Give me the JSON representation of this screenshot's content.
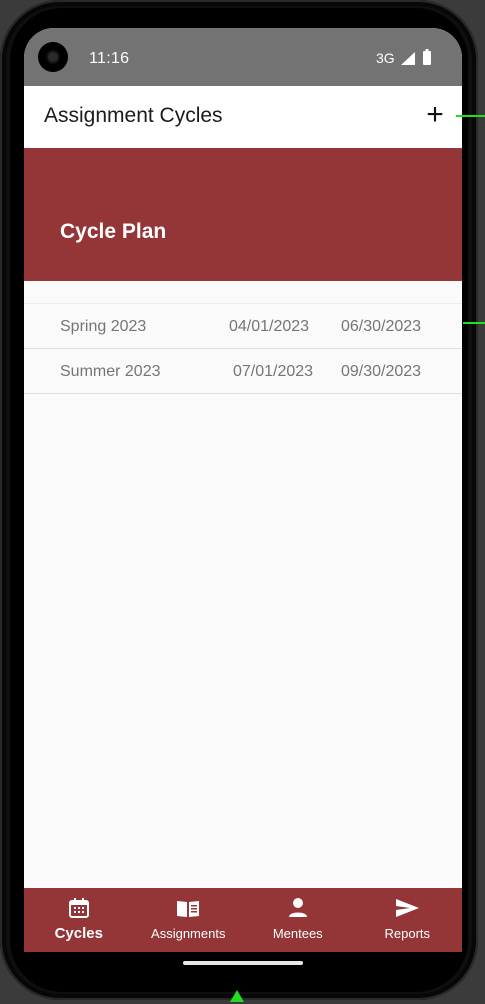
{
  "status_bar": {
    "time": "11:16",
    "network": "3G",
    "icons": [
      "signal-icon",
      "battery-icon"
    ]
  },
  "app_bar": {
    "title": "Assignment Cycles",
    "add_label": "+"
  },
  "hero": {
    "title": "Cycle Plan"
  },
  "cycles": [
    {
      "name": "Spring 2023",
      "start": "04/01/2023",
      "end": "06/30/2023"
    },
    {
      "name": "Summer 2023",
      "start": "07/01/2023",
      "end": "09/30/2023"
    }
  ],
  "bottom_nav": {
    "items": [
      {
        "label": "Cycles",
        "icon": "calendar-icon",
        "active": true
      },
      {
        "label": "Assignments",
        "icon": "book-icon",
        "active": false
      },
      {
        "label": "Mentees",
        "icon": "person-icon",
        "active": false
      },
      {
        "label": "Reports",
        "icon": "send-icon",
        "active": false
      }
    ]
  },
  "colors": {
    "primary": "#943537",
    "status_bar": "#737373",
    "background": "#fafafa",
    "marker": "#22dd22"
  }
}
